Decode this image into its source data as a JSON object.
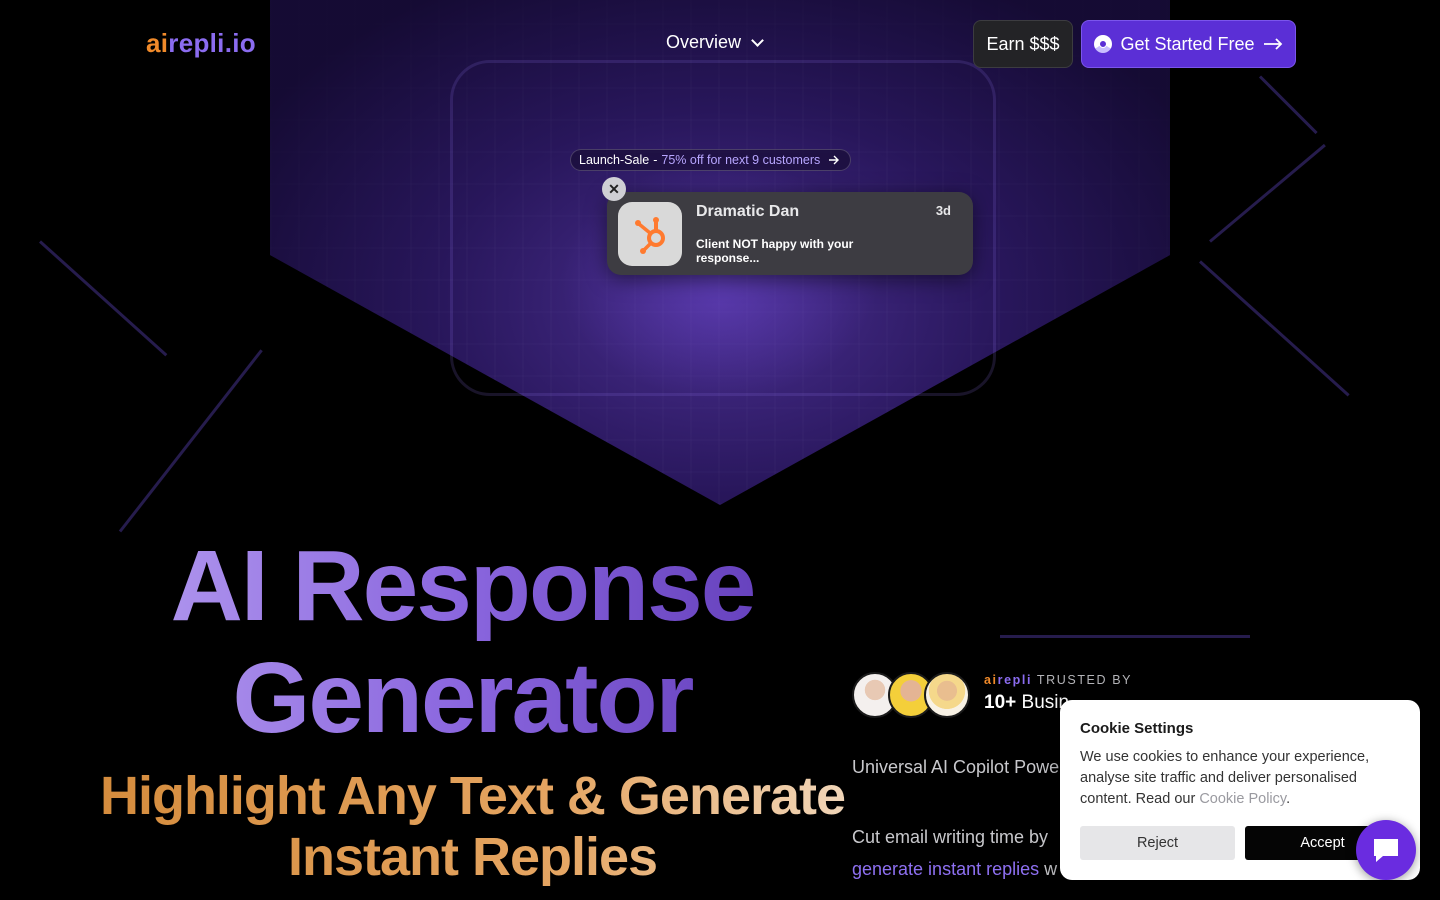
{
  "nav": {
    "logo_ai": "ai",
    "logo_rest": "repli.io",
    "overview_label": "Overview",
    "earn_label": "Earn $$$",
    "get_started_label": "Get Started Free"
  },
  "banner": {
    "lead": "Launch-Sale",
    "separator": "-",
    "offer": "75% off for next 9 customers"
  },
  "notification": {
    "app_icon": "hubspot-icon",
    "sender": "Dramatic Dan",
    "time": "3d",
    "message": "Client NOT happy with your response..."
  },
  "hero": {
    "title": "AI Response Generator",
    "subtitle": "Highlight Any Text & Generate Instant Replies"
  },
  "social_proof": {
    "brand_ai": "ai",
    "brand_rest": "repli",
    "trusted_by": "TRUSTED BY",
    "count": "10+",
    "count_suffix": "Busin"
  },
  "copy": {
    "paragraph1": "Universal AI Copilot Powe",
    "paragraph2": "Cut email writing time by",
    "paragraph3_link": "generate instant replies",
    "paragraph3_rest": "w"
  },
  "cookie": {
    "title": "Cookie Settings",
    "body": "We use cookies to enhance your experience, analyse site traffic and deliver personalised content. Read our ",
    "link": "Cookie Policy",
    "end": ".",
    "reject_label": "Reject",
    "accept_label": "Accept"
  },
  "colors": {
    "accent_orange": "#f08a2a",
    "accent_purple": "#8b6cf0",
    "button_purple": "#5b2fd6",
    "chat_bubble": "#6a2ce0"
  }
}
